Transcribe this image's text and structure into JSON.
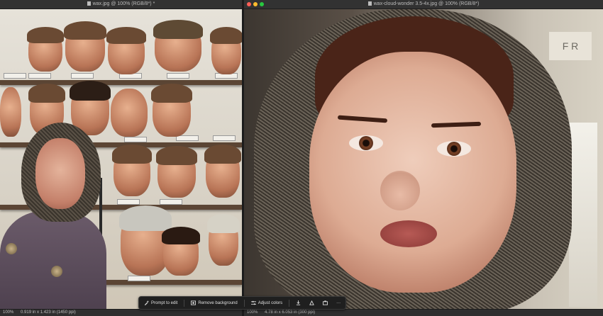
{
  "left_window": {
    "title": "wax.jpg @ 100% (RGB/8*) *",
    "zoom": "100%",
    "doc_info": "0.919 in x 1.423 in (1450 ppi)"
  },
  "right_window": {
    "title": "wax-cloud-wonder 3.5-4x.jpg @ 100% (RGB/8*)",
    "zoom": "100%",
    "doc_info": "4.78 in x 6.053 in (300 ppi)",
    "sign_text": "F R"
  },
  "taskbar": {
    "prompt_label": "Prompt to edit",
    "remove_bg_label": "Remove background",
    "adjust_label": "Adjust colors",
    "more_label": "···"
  },
  "icons": {
    "prompt": "sparkle-pen-icon",
    "remove_bg": "image-cutout-icon",
    "adjust": "sliders-icon",
    "download": "download-icon",
    "mask": "mask-icon",
    "share": "share-icon",
    "more": "more-icon"
  }
}
